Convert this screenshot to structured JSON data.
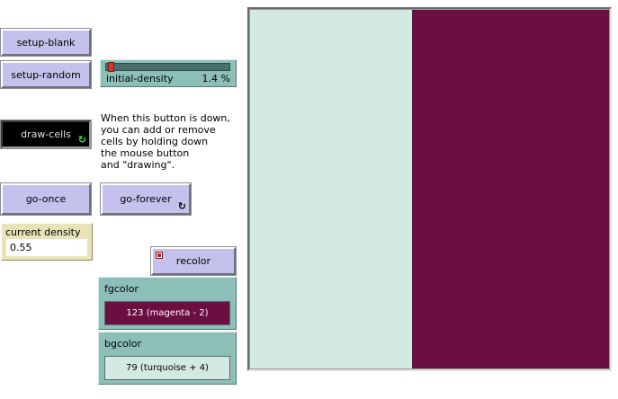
{
  "buttons": {
    "setup_blank": "setup-blank",
    "setup_random": "setup-random",
    "draw_cells": "draw-cells",
    "go_once": "go-once",
    "go_forever": "go-forever",
    "recolor": "recolor",
    "forever_glyph": "↻"
  },
  "slider": {
    "label": "initial-density",
    "value": "1.4 %",
    "level_fraction": 0.014
  },
  "note": {
    "text": "When this button is down,\nyou can add or remove\ncells by holding down\nthe mouse button\nand \"drawing\"."
  },
  "monitor": {
    "label": "current density",
    "value": "0.55"
  },
  "fgcolor": {
    "label": "fgcolor",
    "value": "123 (magenta - 2)",
    "color": "#6b0f43",
    "text_color": "#ffffff"
  },
  "bgcolor": {
    "label": "bgcolor",
    "value": "79 (turquoise + 4)",
    "color": "#d2eae3",
    "text_color": "#000000"
  },
  "view": {
    "left_color": "#d2eae3",
    "right_color": "#6b0f43",
    "left_fraction": 0.45
  },
  "icons": {
    "forever": "forever-icon",
    "recolor_action": "action-icon"
  }
}
